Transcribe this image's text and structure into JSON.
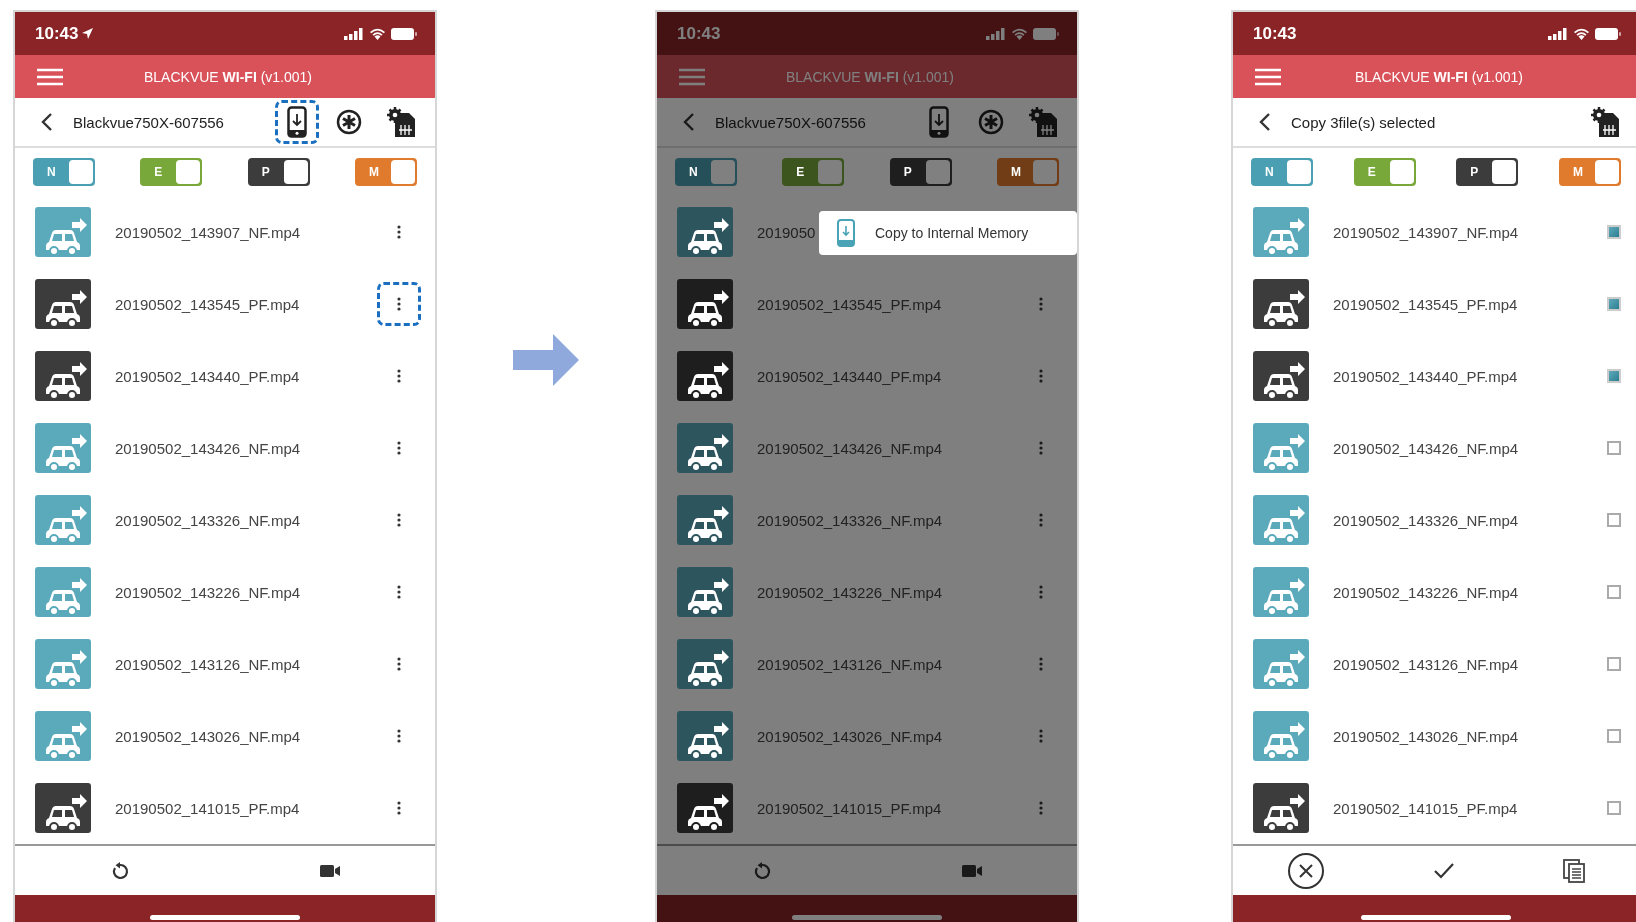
{
  "screens": [
    {
      "kind": "list",
      "status_bar": {
        "time": "10:43",
        "location_arrow": true
      },
      "title": "BLACKVUE **WI-FI** (v1.001)",
      "subheader": {
        "title": "Blackvue750X-607556",
        "actions": [
          {
            "kind": "phone-download",
            "highlighted": true
          },
          {
            "kind": "dial"
          },
          {
            "kind": "sd-settings"
          }
        ]
      },
      "filters": [
        {
          "label": "N",
          "color": "#4a9fb3"
        },
        {
          "label": "E",
          "color": "#78a83a"
        },
        {
          "label": "P",
          "color": "#3c3c3c"
        },
        {
          "label": "M",
          "color": "#e07a2c"
        }
      ],
      "files": [
        {
          "name": "20190502_143907_NF.mp4",
          "color": "#5aaabb",
          "highlighted": false
        },
        {
          "name": "20190502_143545_PF.mp4",
          "color": "#3c3c3c",
          "highlighted": true
        },
        {
          "name": "20190502_143440_PF.mp4",
          "color": "#3c3c3c",
          "highlighted": false
        },
        {
          "name": "20190502_143426_NF.mp4",
          "color": "#5aaabb",
          "highlighted": false
        },
        {
          "name": "20190502_143326_NF.mp4",
          "color": "#5aaabb",
          "highlighted": false
        },
        {
          "name": "20190502_143226_NF.mp4",
          "color": "#5aaabb",
          "highlighted": false
        },
        {
          "name": "20190502_143126_NF.mp4",
          "color": "#5aaabb",
          "highlighted": false
        },
        {
          "name": "20190502_143026_NF.mp4",
          "color": "#5aaabb",
          "highlighted": false
        },
        {
          "name": "20190502_141015_PF.mp4",
          "color": "#3c3c3c",
          "highlighted": false
        }
      ],
      "bottom_actions": [
        {
          "kind": "refresh"
        },
        {
          "kind": "camera"
        }
      ]
    },
    {
      "kind": "list",
      "dimmed": true,
      "status_bar": {
        "time": "10:43"
      },
      "title": "BLACKVUE **WI-FI** (v1.001)",
      "subheader": {
        "title": "Blackvue750X-607556",
        "actions": [
          {
            "kind": "phone-download",
            "highlighted": false
          },
          {
            "kind": "dial"
          },
          {
            "kind": "sd-settings"
          }
        ]
      },
      "filters": [
        {
          "label": "N",
          "color": "#255059"
        },
        {
          "label": "E",
          "color": "#3c541d"
        },
        {
          "label": "P",
          "color": "#1e1e1e"
        },
        {
          "label": "M",
          "color": "#703d16"
        }
      ],
      "files": [
        {
          "name": "2019050",
          "color": "#2d555e",
          "highlighted": false
        },
        {
          "name": "20190502_143545_PF.mp4",
          "color": "#1e1e1e",
          "highlighted": false
        },
        {
          "name": "20190502_143440_PF.mp4",
          "color": "#1e1e1e",
          "highlighted": false
        },
        {
          "name": "20190502_143426_NF.mp4",
          "color": "#2d555e",
          "highlighted": false
        },
        {
          "name": "20190502_143326_NF.mp4",
          "color": "#2d555e",
          "highlighted": false
        },
        {
          "name": "20190502_143226_NF.mp4",
          "color": "#2d555e",
          "highlighted": false
        },
        {
          "name": "20190502_143126_NF.mp4",
          "color": "#2d555e",
          "highlighted": false
        },
        {
          "name": "20190502_143026_NF.mp4",
          "color": "#2d555e",
          "highlighted": false
        },
        {
          "name": "20190502_141015_PF.mp4",
          "color": "#1e1e1e",
          "highlighted": false
        }
      ],
      "bottom_actions": [
        {
          "kind": "refresh"
        },
        {
          "kind": "camera"
        }
      ],
      "popup": {
        "label": "Copy to Internal Memory"
      }
    },
    {
      "kind": "select",
      "status_bar": {
        "time": "10:43"
      },
      "title": "BLACKVUE **WI-FI** (v1.001)",
      "subheader": {
        "title": "Copy 3file(s) selected",
        "actions": [
          {
            "kind": "sd-settings"
          }
        ]
      },
      "filters": [
        {
          "label": "N",
          "color": "#4a9fb3"
        },
        {
          "label": "E",
          "color": "#78a83a"
        },
        {
          "label": "P",
          "color": "#3c3c3c"
        },
        {
          "label": "M",
          "color": "#e07a2c"
        }
      ],
      "files": [
        {
          "name": "20190502_143907_NF.mp4",
          "color": "#5aaabb",
          "checked": true
        },
        {
          "name": "20190502_143545_PF.mp4",
          "color": "#3c3c3c",
          "checked": true
        },
        {
          "name": "20190502_143440_PF.mp4",
          "color": "#3c3c3c",
          "checked": true
        },
        {
          "name": "20190502_143426_NF.mp4",
          "color": "#5aaabb",
          "checked": false
        },
        {
          "name": "20190502_143326_NF.mp4",
          "color": "#5aaabb",
          "checked": false
        },
        {
          "name": "20190502_143226_NF.mp4",
          "color": "#5aaabb",
          "checked": false
        },
        {
          "name": "20190502_143126_NF.mp4",
          "color": "#5aaabb",
          "checked": false
        },
        {
          "name": "20190502_143026_NF.mp4",
          "color": "#5aaabb",
          "checked": false
        },
        {
          "name": "20190502_141015_PF.mp4",
          "color": "#3c3c3c",
          "checked": false
        }
      ],
      "bottom_actions": [
        {
          "kind": "cancel"
        },
        {
          "kind": "confirm"
        },
        {
          "kind": "copy"
        }
      ]
    }
  ]
}
